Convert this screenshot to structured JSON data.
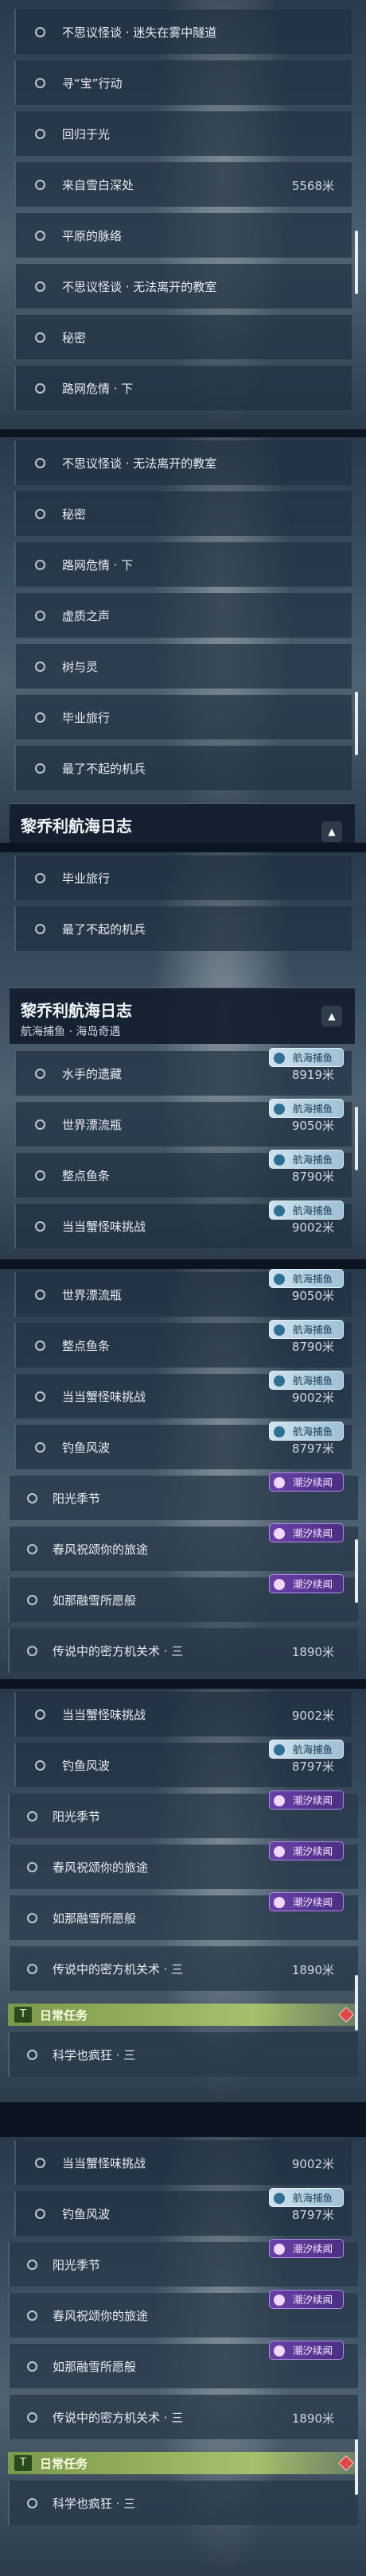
{
  "quests": {
    "q1": "不思议怪谈 · 迷失在雾中隧道",
    "q2": "寻“宝”行动",
    "q3": "回归于光",
    "q4": "来自雪白深处",
    "q4_dist": "5568米",
    "q5": "平原的脉络",
    "q6": "不思议怪谈 · 无法离开的教室",
    "q7": "秘密",
    "q8": "路网危情 · 下",
    "q9": "虚质之声",
    "q10": "树与灵",
    "q11": "毕业旅行",
    "q12": "最了不起的机兵",
    "f1": "水手的遗藏",
    "f1_dist": "8919米",
    "f2": "世界漂流瓶",
    "f2_dist": "9050米",
    "f3": "整点鱼条",
    "f3_dist": "8790米",
    "f4": "当当蟹怪味挑战",
    "f4_dist": "9002米",
    "f5": "钓鱼风波",
    "f5_dist": "8797米",
    "c1": "阳光季节",
    "c2": "春风祝颂你的旅途",
    "c3": "如那融雪所愿般",
    "c4": "传说中的密方机关术 · 三",
    "c4_dist": "1890米",
    "d1": "科学也疯狂 · 三"
  },
  "section": {
    "title": "黎乔利航海日志",
    "subtitle": "航海捕鱼 · 海岛奇遇",
    "collapse_icon": "▲"
  },
  "tags": {
    "fishing": "航海捕鱼",
    "tide": "潮汐续闻"
  },
  "daily": {
    "title": "日常任务",
    "icon": "T"
  },
  "colors": {
    "fishing_tag": "#9cc1d6",
    "tide_tag": "#6a3fa8",
    "daily_bar": "#a7c06a",
    "alert": "#e04848"
  }
}
